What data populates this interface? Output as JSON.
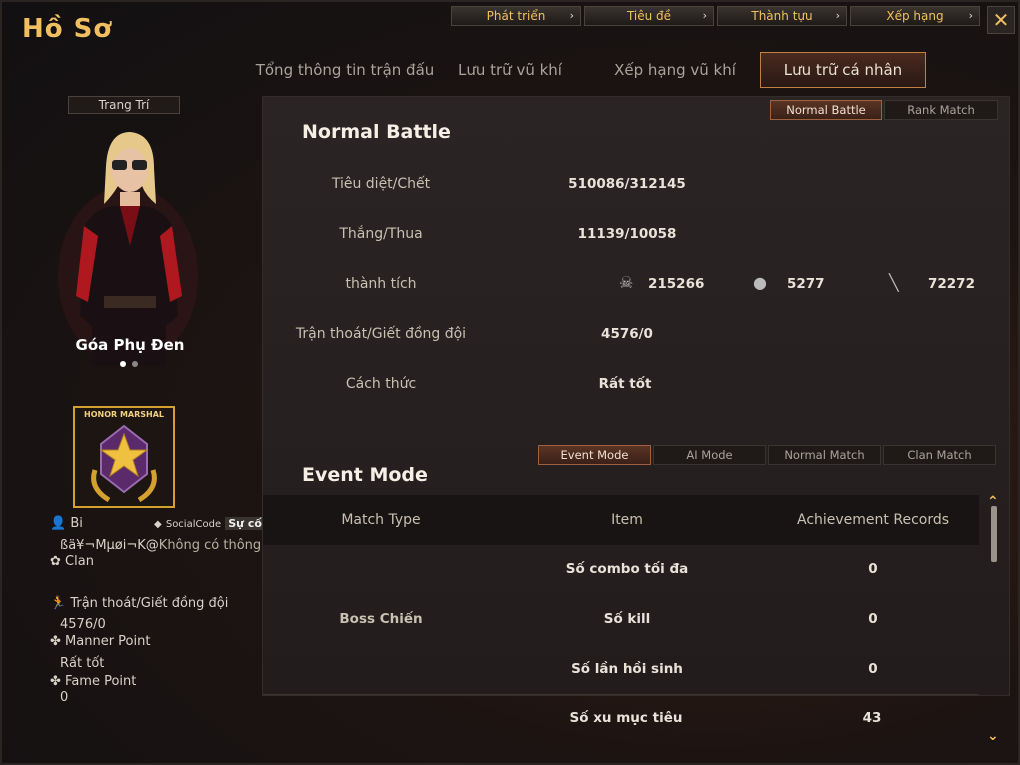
{
  "title": "Hồ Sơ",
  "topnav": [
    {
      "label": "Phát triển"
    },
    {
      "label": "Tiêu đề"
    },
    {
      "label": "Thành tựu"
    },
    {
      "label": "Xếp hạng"
    }
  ],
  "close_label": "✕",
  "tabs": [
    {
      "label": "Tổng thông tin trận đấu"
    },
    {
      "label": "Lưu trữ vũ khí"
    },
    {
      "label": "Xếp hạng vũ khí"
    },
    {
      "label": "Lưu trữ cá nhân"
    }
  ],
  "left": {
    "trang_tri": "Trang Trí",
    "character_name": "Góa Phụ Đen",
    "badge_label": "HONOR MARSHAL",
    "player_name": "Bi",
    "social_code_label": "SocialCode",
    "social_code_value": "Sự cố",
    "nickname": "ßä¥¬Mµøi¬K@",
    "no_info": "Không có thông tin",
    "clan_label": "Clan",
    "desert_label": "Trận thoát/Giết đồng đội",
    "desert_value": "4576/0",
    "manner_label": "Manner Point",
    "manner_value": "Rất tốt",
    "fame_label": "Fame Point",
    "fame_value": "0"
  },
  "mode_tabs": [
    {
      "label": "Normal Battle"
    },
    {
      "label": "Rank Match"
    }
  ],
  "normal_battle": {
    "title": "Normal Battle",
    "rows": [
      {
        "label": "Tiêu diệt/Chết",
        "value": "510086/312145"
      },
      {
        "label": "Thắng/Thua",
        "value": "11139/10058"
      },
      {
        "label": "thành tích",
        "value": ""
      },
      {
        "label": "Trận thoát/Giết đồng đội",
        "value": "4576/0"
      },
      {
        "label": "Cách thức",
        "value": "Rất tốt"
      }
    ],
    "achievements": [
      {
        "icon": "skull-crossbones-icon",
        "value": "215266"
      },
      {
        "icon": "grenade-icon",
        "value": "5277"
      },
      {
        "icon": "knife-icon",
        "value": "72272"
      }
    ]
  },
  "event_tabs": [
    {
      "label": "Event Mode"
    },
    {
      "label": "AI Mode"
    },
    {
      "label": "Normal Match"
    },
    {
      "label": "Clan Match"
    }
  ],
  "event_mode": {
    "title": "Event Mode",
    "headers": [
      "Match Type",
      "Item",
      "Achievement Records"
    ],
    "match_type": "Boss Chiến",
    "rows": [
      {
        "item": "Số combo tối đa",
        "value": "0"
      },
      {
        "item": "Số kill",
        "value": "0"
      },
      {
        "item": "Số lần hồi sinh",
        "value": "0"
      },
      {
        "item": "Số xu mục tiêu",
        "value": "43"
      }
    ]
  },
  "colors": {
    "accent": "#f0c060",
    "active_tab": "#c08040",
    "bg": "#1d1412"
  }
}
